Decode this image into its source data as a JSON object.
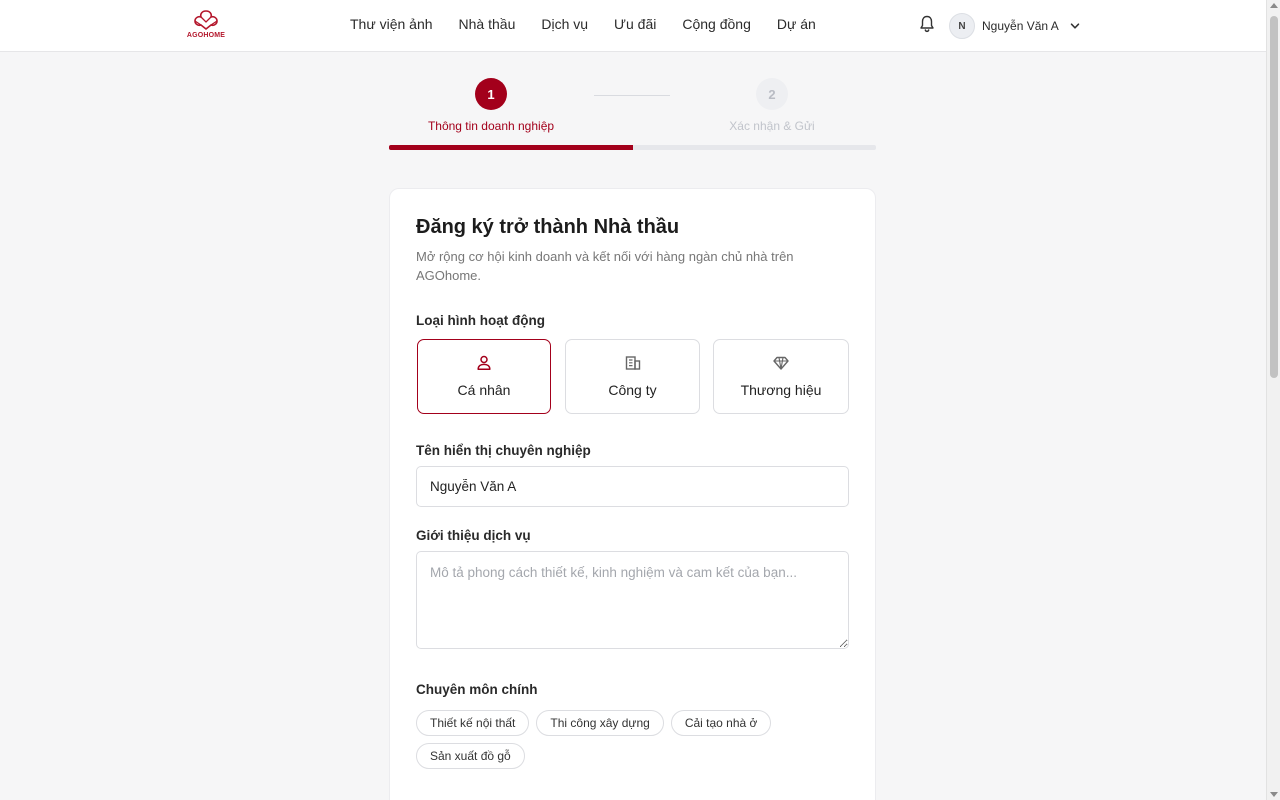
{
  "brand": {
    "name": "AGOHOME",
    "color": "#b4172c"
  },
  "nav": {
    "items": [
      "Thư viện ảnh",
      "Nhà thầu",
      "Dịch vụ",
      "Ưu đãi",
      "Cộng đồng",
      "Dự án"
    ]
  },
  "user": {
    "initial": "N",
    "name": "Nguyễn Văn A"
  },
  "stepper": {
    "steps": [
      {
        "number": "1",
        "label": "Thông tin doanh nghiệp",
        "state": "active"
      },
      {
        "number": "2",
        "label": "Xác nhận & Gửi",
        "state": "inactive"
      }
    ],
    "progress_fraction": 0.5,
    "accent": "#a3001b"
  },
  "form": {
    "title": "Đăng ký trở thành Nhà thầu",
    "subtitle": "Mở rộng cơ hội kinh doanh và kết nối với hàng ngàn chủ nhà trên AGOhome.",
    "type_label": "Loại hình hoạt động",
    "types": [
      {
        "label": "Cá nhân",
        "icon": "person-icon",
        "selected": true
      },
      {
        "label": "Công ty",
        "icon": "building-icon",
        "selected": false
      },
      {
        "label": "Thương hiệu",
        "icon": "diamond-icon",
        "selected": false
      }
    ],
    "display_name_label": "Tên hiển thị chuyên nghiệp",
    "display_name_value": "Nguyễn Văn A",
    "intro_label": "Giới thiệu dịch vụ",
    "intro_placeholder": "Mô tả phong cách thiết kế, kinh nghiệm và cam kết của bạn...",
    "specialty_label": "Chuyên môn chính",
    "specialties": [
      "Thiết kế nội thất",
      "Thi công xây dựng",
      "Cải tạo nhà ở",
      "Sản xuất đồ gỗ"
    ]
  }
}
